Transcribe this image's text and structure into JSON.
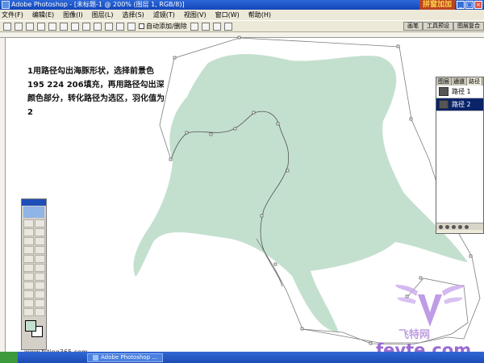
{
  "window": {
    "title": "Adobe Photoshop - [未标题-1 @ 200% (图层 1, RGB/8)]",
    "brand_badge": "拼窗加加",
    "buttons": [
      "_",
      "□",
      "×"
    ]
  },
  "menubar": {
    "items": [
      "文件(F)",
      "编辑(E)",
      "图像(I)",
      "图层(L)",
      "选择(S)",
      "滤镜(T)",
      "视图(V)",
      "窗口(W)",
      "帮助(H)"
    ]
  },
  "options": {
    "auto_add_label": "自动添加/删除",
    "palette_tabs": [
      "画笔",
      "工具预设",
      "图层复合"
    ]
  },
  "instructions": {
    "text": "1用路径勾出海豚形状，选择前景色195 224 206填充，再用路径勾出深颜色部分，转化路径为选区，羽化值为2"
  },
  "paths_panel": {
    "tabs": [
      "图层",
      "通道",
      "路径"
    ],
    "active_tab": "路径",
    "items": [
      {
        "label": "路径 1",
        "selected": false
      },
      {
        "label": "路径 2",
        "selected": true
      }
    ]
  },
  "foreground_color": {
    "r": 195,
    "g": 224,
    "b": 206,
    "hex": "#c3e0ce"
  },
  "watermark": {
    "site_cn": "飞特网",
    "brand": "fevte.com",
    "corner": "www.fsting365.com"
  },
  "taskbar": {
    "task_label": "Adobe Photoshop ..."
  }
}
